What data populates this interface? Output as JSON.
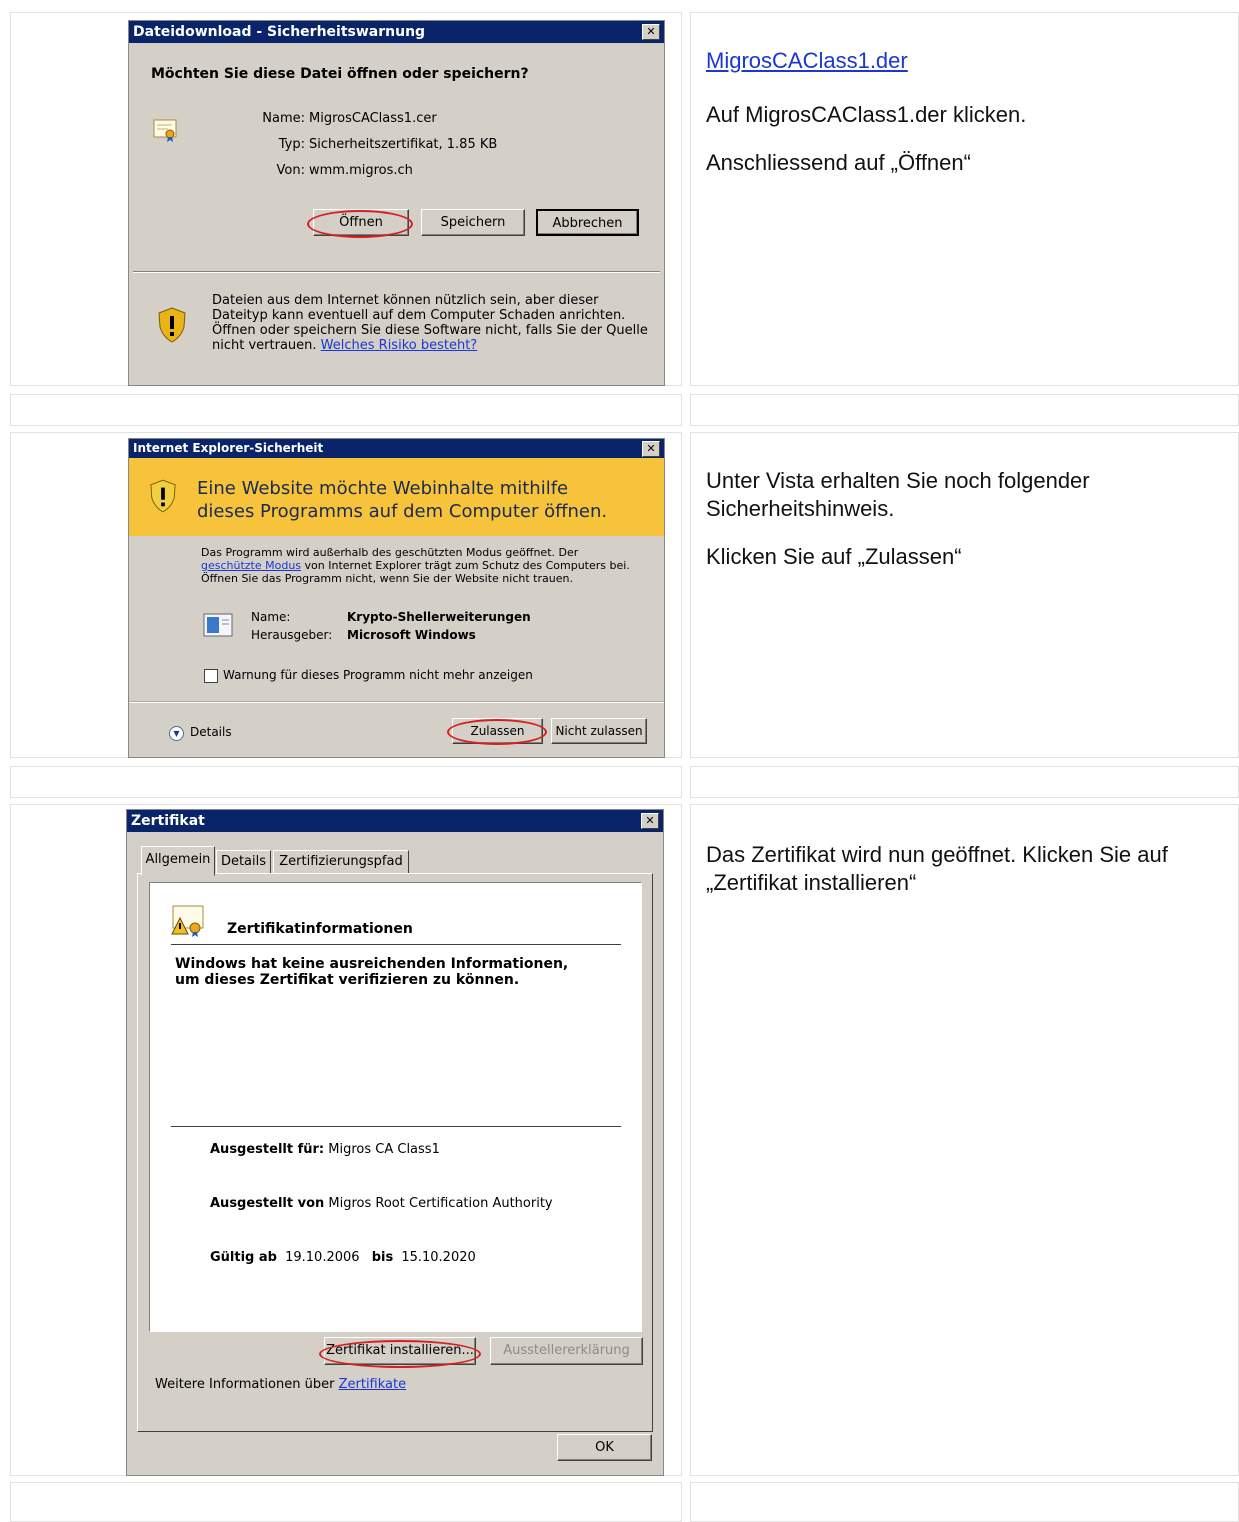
{
  "rows": [
    {
      "description": {
        "link": "MigrosCAClass1.der",
        "lines": [
          "Auf MigrosCAClass1.der klicken.",
          "Anschliessend auf „Öffnen“"
        ]
      }
    },
    {
      "description": {
        "lines": [
          "Unter Vista erhalten Sie noch folgender Sicherheitshinweis.",
          "Klicken Sie auf „Zulassen“"
        ]
      }
    },
    {
      "description": {
        "lines": [
          "Das Zertifikat wird nun geöffnet. Klicken Sie auf „Zertifikat installieren“"
        ]
      }
    }
  ],
  "download_dialog": {
    "title": "Dateidownload - Sicherheitswarnung",
    "question": "Möchten Sie diese Datei öffnen oder speichern?",
    "name_label": "Name:",
    "name_value": "MigrosCAClass1.cer",
    "type_label": "Typ:",
    "type_value": "Sicherheitszertifikat, 1.85 KB",
    "from_label": "Von:",
    "from_value": "wmm.migros.ch",
    "open_label": "Öffnen",
    "save_label": "Speichern",
    "cancel_label": "Abbrechen",
    "warning_text": "Dateien aus dem Internet können nützlich sein, aber dieser Dateityp kann eventuell auf dem Computer Schaden anrichten. Öffnen oder speichern Sie diese Software nicht, falls Sie der Quelle nicht vertrauen.",
    "risk_link": "Welches Risiko besteht?"
  },
  "ie_dialog": {
    "title": "Internet Explorer-Sicherheit",
    "banner": "Eine Website möchte Webinhalte mithilfe dieses Programms auf dem Computer öffnen.",
    "body_pre": "Das Programm wird außerhalb des geschützten Modus geöffnet. Der",
    "body_link": "geschützte Modus",
    "body_post": "von Internet Explorer trägt zum Schutz des Computers bei. Öffnen Sie das Programm nicht, wenn Sie der Website nicht trauen.",
    "name_label": "Name:",
    "name_value": "Krypto-Shellerweiterungen",
    "publisher_label": "Herausgeber:",
    "publisher_value": "Microsoft Windows",
    "checkbox_label": "Warnung für dieses Programm nicht mehr anzeigen",
    "details_label": "Details",
    "allow_label": "Zulassen",
    "deny_label": "Nicht zulassen"
  },
  "cert_dialog": {
    "title": "Zertifikat",
    "tabs": [
      "Allgemein",
      "Details",
      "Zertifizierungspfad"
    ],
    "heading": "Zertifikatinformationen",
    "warning": "Windows hat keine ausreichenden Informationen, um dieses Zertifikat verifizieren zu können.",
    "issued_to_label": "Ausgestellt für:",
    "issued_to_value": "Migros CA Class1",
    "issued_by_label": "Ausgestellt von",
    "issued_by_value": "Migros Root Certification Authority",
    "valid_from_label": "Gültig ab",
    "valid_from_value": "19.10.2006",
    "valid_to_label": "bis",
    "valid_to_value": "15.10.2020",
    "install_label": "Zertifikat installieren...",
    "issuer_statement_label": "Ausstellererklärung",
    "more_info_text": "Weitere Informationen über",
    "more_info_link": "Zertifikate",
    "ok_label": "OK"
  },
  "colors": {
    "titlebar": "#0a246a",
    "dialog_bg": "#d4d0c8",
    "banner": "#f7c33a",
    "annotation": "#d62020",
    "link": "#1a36d6"
  }
}
